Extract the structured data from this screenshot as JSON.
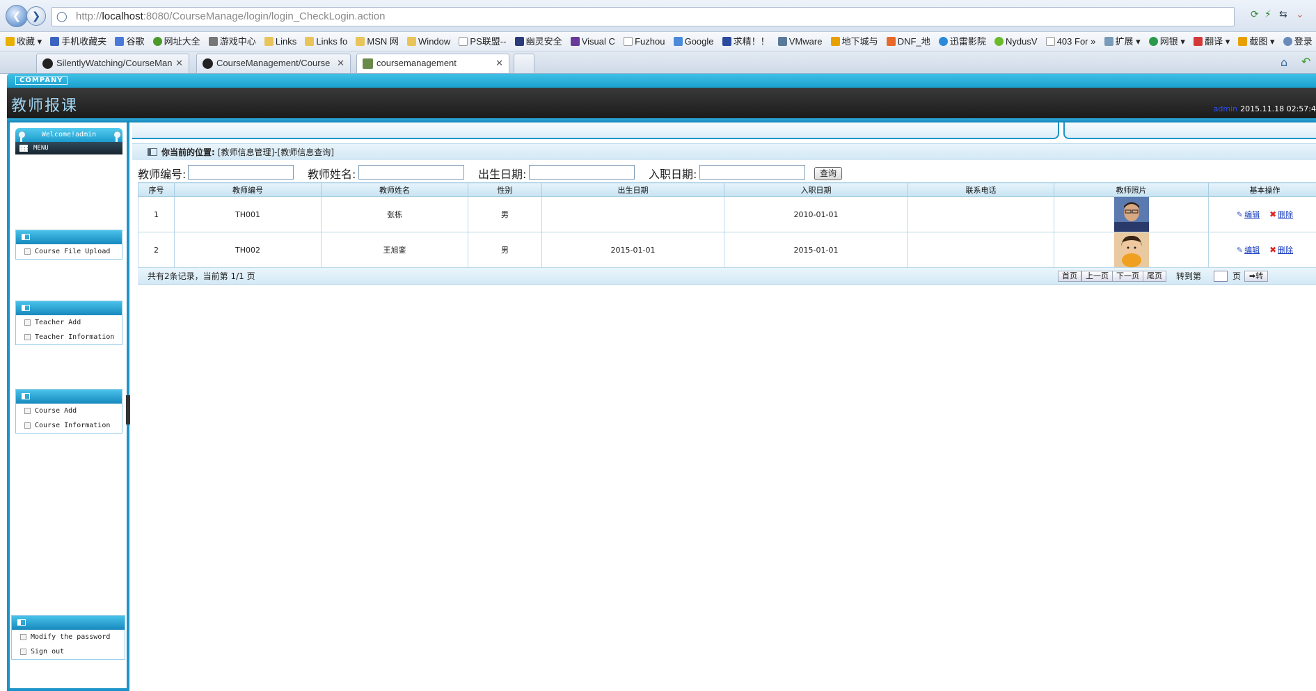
{
  "browser": {
    "url_prefix": "http://",
    "url_host": "localhost",
    "url_rest": ":8080/CourseManage/login/login_CheckLogin.action",
    "bookmarks": [
      "收藏",
      "手机收藏夹",
      "谷歌",
      "网址大全",
      "游戏中心",
      "Links",
      "Links fo",
      "MSN 网",
      "Window",
      "PS联盟--",
      "幽灵安全",
      "Visual C",
      "Fuzhou",
      "Google",
      "求精！！",
      "VMware",
      "地下城与",
      "DNF_地",
      "迅雷影院",
      "NydusV",
      "403 For",
      "扩展",
      "网银",
      "翻译",
      "截图",
      "登录"
    ],
    "tabs": [
      {
        "label": "SilentlyWatching/CourseMan"
      },
      {
        "label": "CourseManagement/Course"
      },
      {
        "label": "coursemanagement"
      }
    ]
  },
  "header": {
    "company": "COMPANY",
    "title": "教师报课",
    "user": "admin",
    "datetime": "2015.11.18 02:57:4"
  },
  "sidebar": {
    "welcome": "Welcome!admin",
    "menu_label": "MENU",
    "groups": [
      {
        "items": [
          "Course File Upload"
        ]
      },
      {
        "items": [
          "Teacher Add",
          "Teacher Information"
        ]
      },
      {
        "items": [
          "Course Add",
          "Course Information"
        ]
      },
      {
        "items": [
          "Modify the password",
          "Sign out"
        ]
      }
    ]
  },
  "location": {
    "label": "你当前的位置:",
    "path": "[教师信息管理]-[教师信息查询]"
  },
  "search": {
    "teacher_no_label": "教师编号:",
    "teacher_name_label": "教师姓名:",
    "birth_label": "出生日期:",
    "hire_label": "入职日期:",
    "query_button": "查询"
  },
  "table": {
    "headers": [
      "序号",
      "教师编号",
      "教师姓名",
      "性别",
      "出生日期",
      "入职日期",
      "联系电话",
      "教师照片",
      "基本操作"
    ],
    "rows": [
      {
        "index": "1",
        "teacher_no": "TH001",
        "name": "张栋",
        "gender": "男",
        "birth": "",
        "hire": "2010-01-01",
        "phone": ""
      },
      {
        "index": "2",
        "teacher_no": "TH002",
        "name": "王旭銮",
        "gender": "男",
        "birth": "2015-01-01",
        "hire": "2015-01-01",
        "phone": ""
      }
    ],
    "edit_label": "编辑",
    "delete_label": "删除"
  },
  "pager": {
    "summary": "共有2条记录，当前第 1/1 页",
    "first": "首页",
    "prev": "上一页",
    "next": "下一页",
    "last": "尾页",
    "goto_label": "转到第",
    "page_unit": "页",
    "go_button": "➡转"
  }
}
